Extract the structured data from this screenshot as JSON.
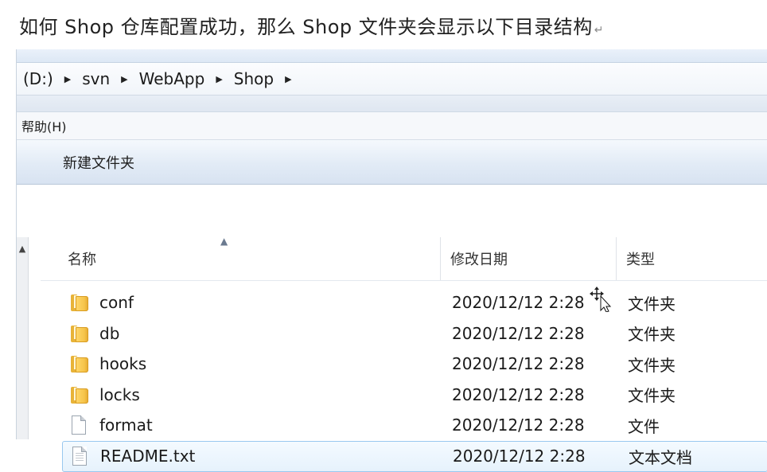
{
  "caption": {
    "text": "如何 Shop 仓库配置成功，那么 Shop 文件夹会显示以下目录结构",
    "return_mark": "↵"
  },
  "breadcrumb": {
    "items": [
      "(D:)",
      "svn",
      "WebApp",
      "Shop"
    ],
    "separator_icon": "triangle-right-icon"
  },
  "menubar": {
    "help": "帮助(H)"
  },
  "toolbar": {
    "new_folder": "新建文件夹"
  },
  "columns": {
    "name": "名称",
    "date": "修改日期",
    "type": "类型"
  },
  "files": [
    {
      "name": "conf",
      "date": "2020/12/12 2:28",
      "type": "文件夹",
      "icon": "folder-icon"
    },
    {
      "name": "db",
      "date": "2020/12/12 2:28",
      "type": "文件夹",
      "icon": "folder-icon"
    },
    {
      "name": "hooks",
      "date": "2020/12/12 2:28",
      "type": "文件夹",
      "icon": "folder-icon"
    },
    {
      "name": "locks",
      "date": "2020/12/12 2:28",
      "type": "文件夹",
      "icon": "folder-icon"
    },
    {
      "name": "format",
      "date": "2020/12/12 2:28",
      "type": "文件",
      "icon": "file-icon"
    },
    {
      "name": "README.txt",
      "date": "2020/12/12 2:28",
      "type": "文本文档",
      "icon": "text-file-icon"
    }
  ],
  "colors": {
    "folder": "#f6c44a",
    "selection_border": "#99c8ef",
    "toolbar_bg": "#e2ebf6"
  }
}
